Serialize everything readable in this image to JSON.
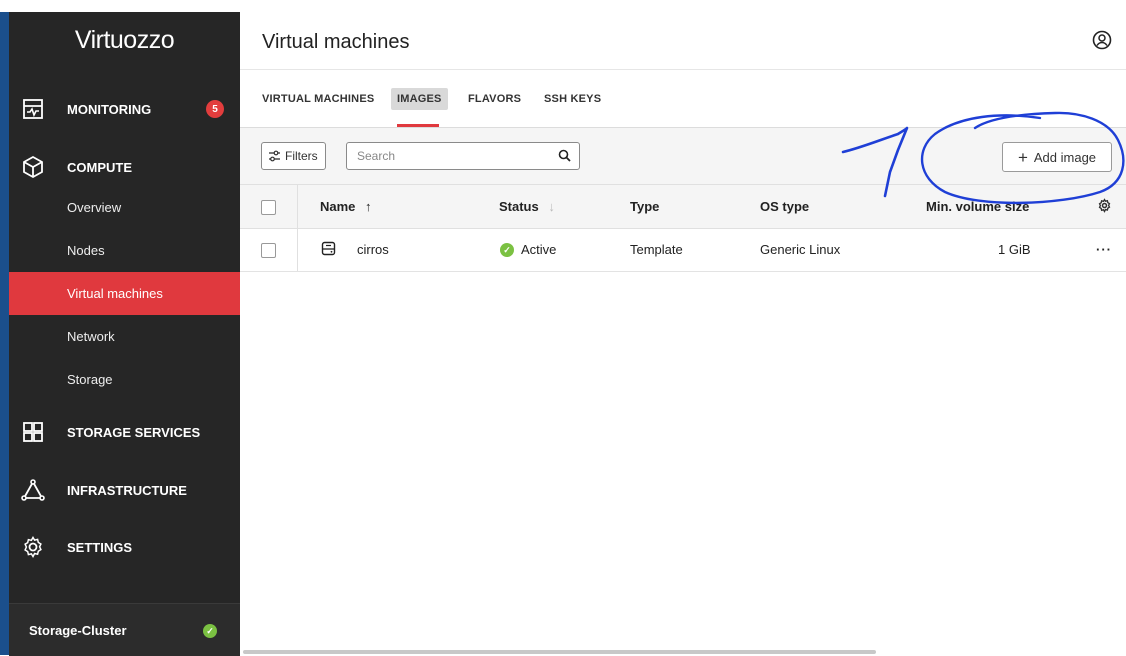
{
  "app": {
    "logo": "Virtuozzo"
  },
  "sidebar": {
    "sections": [
      {
        "label": "MONITORING",
        "icon": "monitoring-icon",
        "badge": "5"
      },
      {
        "label": "COMPUTE",
        "icon": "cube-icon"
      },
      {
        "label": "STORAGE SERVICES",
        "icon": "grid-icon"
      },
      {
        "label": "INFRASTRUCTURE",
        "icon": "triangle-nodes-icon"
      },
      {
        "label": "SETTINGS",
        "icon": "gear-icon"
      }
    ],
    "compute_items": [
      "Overview",
      "Nodes",
      "Virtual machines",
      "Network",
      "Storage"
    ],
    "active_item": "Virtual machines",
    "cluster": {
      "label": "Storage-Cluster",
      "status": "ok"
    }
  },
  "header": {
    "title": "Virtual machines",
    "user_icon": "user-icon"
  },
  "tabs": [
    {
      "label": "VIRTUAL MACHINES",
      "active": false
    },
    {
      "label": "IMAGES",
      "active": true
    },
    {
      "label": "FLAVORS",
      "active": false
    },
    {
      "label": "SSH KEYS",
      "active": false
    }
  ],
  "toolbar": {
    "filters_label": "Filters",
    "search_placeholder": "Search",
    "add_label": "Add image"
  },
  "table": {
    "columns": [
      "Name",
      "Status",
      "Type",
      "OS type",
      "Min. volume size"
    ],
    "sort": {
      "column": "Name",
      "direction": "asc"
    },
    "rows": [
      {
        "name": "cirros",
        "status": "Active",
        "type": "Template",
        "os_type": "Generic Linux",
        "min_volume": "1 GiB",
        "actions": "···"
      }
    ]
  },
  "colors": {
    "sidebar_bg": "#262626",
    "accent_red": "#e0393e",
    "ok_green": "#7bc142",
    "annotation_blue": "#1f3fd6"
  }
}
